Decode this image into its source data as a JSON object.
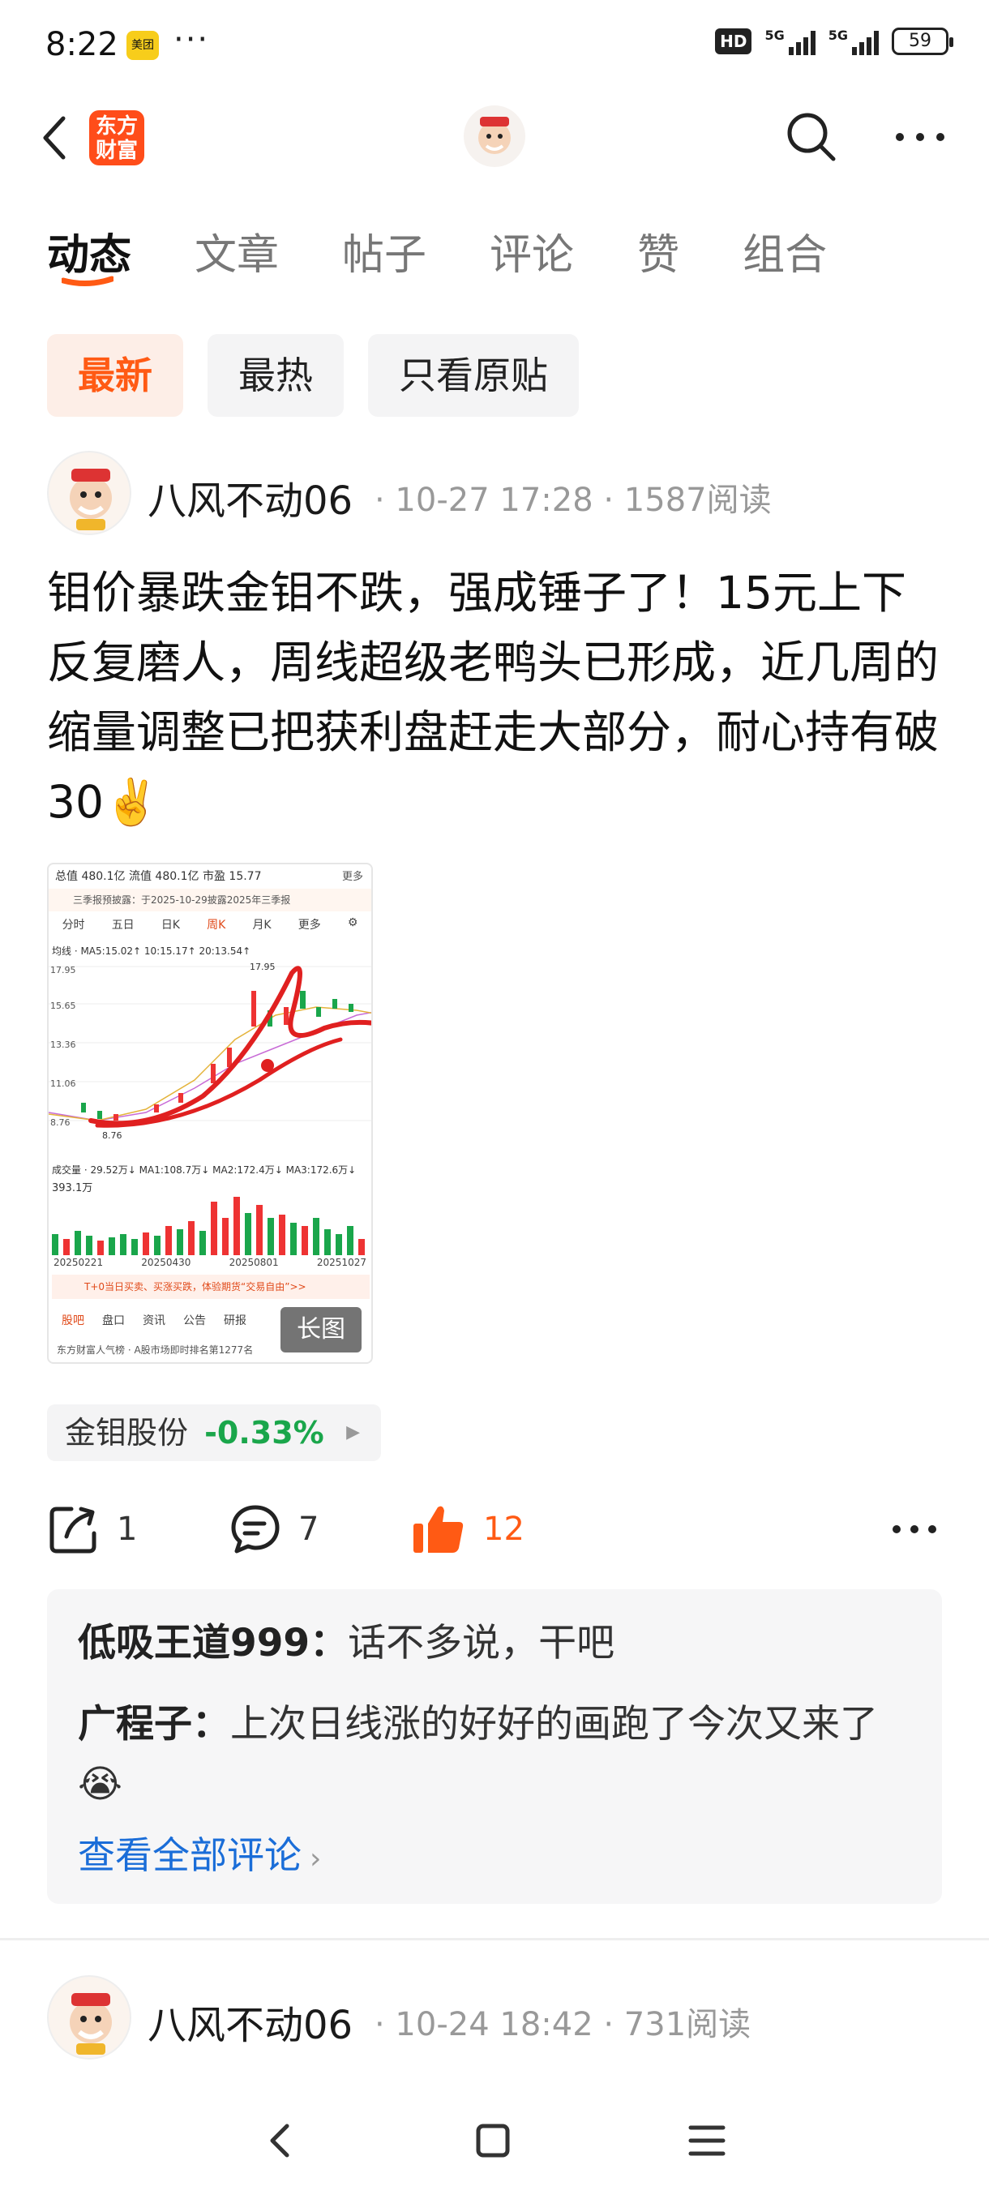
{
  "status_bar": {
    "time": "8:22",
    "app_badge": "美团",
    "dots": "···",
    "hd": "HD",
    "net1": "5G",
    "net2": "5G",
    "battery": "59"
  },
  "header": {
    "logo_text": "东方财富"
  },
  "tabs": [
    {
      "label": "动态",
      "active": true
    },
    {
      "label": "文章",
      "active": false
    },
    {
      "label": "帖子",
      "active": false
    },
    {
      "label": "评论",
      "active": false
    },
    {
      "label": "赞",
      "active": false
    },
    {
      "label": "组合",
      "active": false
    }
  ],
  "filters": [
    {
      "label": "最新",
      "active": true
    },
    {
      "label": "最热",
      "active": false
    },
    {
      "label": "只看原贴",
      "active": false
    }
  ],
  "post": {
    "author": "八风不动06",
    "meta": "· 10-27 17:28 · 1587阅读",
    "text": "钼价暴跌金钼不跌，强成锤子了！15元上下反复磨人，周线超级老鸭头已形成，近几周的缩量调整已把获利盘赶走大部分，耐心持有破30✌️",
    "image": {
      "top_row": "总值 480.1亿  流值 480.1亿  市盈 15.77",
      "more": "更多",
      "notice": "三季报预披露：于2025-10-29披露2025年三季报",
      "periods": [
        "分时",
        "五日",
        "日K",
        "周K",
        "月K",
        "更多",
        "⚙"
      ],
      "ma_line": "均线 · MA5:15.02↑ 10:15.17↑ 20:13.54↑",
      "price_labels": [
        "17.95",
        "15.65",
        "13.36",
        "11.06",
        "8.76"
      ],
      "high_label": "17.95",
      "low_label": "8.76",
      "vol_line": "成交量 · 29.52万↓ MA1:108.7万↓ MA2:172.4万↓ MA3:172.6万↓",
      "vol_max": "393.1万",
      "dates": [
        "20250221",
        "20250430",
        "20250801",
        "20251027"
      ],
      "promo": "T+0当日买卖、买涨买跌，体验期货“交易自由”>>",
      "bottom_tabs": [
        "股吧",
        "盘口",
        "资讯",
        "公告",
        "研报"
      ],
      "rank": "东方财富人气榜 · A股市场即时排名第1277名",
      "long_badge": "长图"
    },
    "stock_tag": {
      "name": "金钼股份",
      "change": "-0.33%"
    },
    "actions": {
      "share": "1",
      "comment": "7",
      "like": "12"
    },
    "comments": [
      {
        "name": "低吸王道999：",
        "text": "话不多说，干吧"
      },
      {
        "name": "广程子：",
        "text": "上次日线涨的好好的画跑了今次又来了😭"
      }
    ],
    "view_all": "查看全部评论"
  },
  "next_post": {
    "author": "八风不动06",
    "meta": "· 10-24 18:42 · 731阅读"
  },
  "colors": {
    "accent": "#ff5a14",
    "link": "#1a6dd8",
    "down": "#1aa64b"
  }
}
